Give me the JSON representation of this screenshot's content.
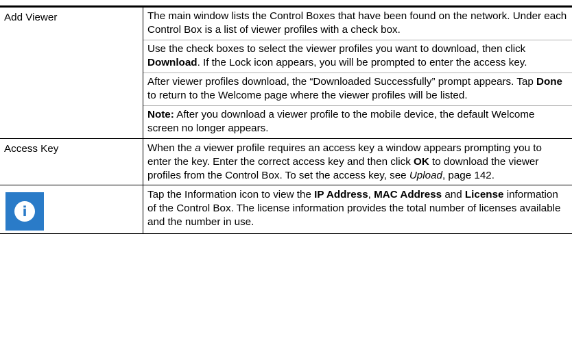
{
  "rows": [
    {
      "label": "Add Viewer",
      "paragraphs": [
        {
          "text": "The main window lists the Control Boxes that have been found on the network. Under each Control Box is a list of viewer profiles with a check box."
        },
        {
          "p1": "Use the check boxes to select the viewer profiles you want to download, then click ",
          "b1": "Download",
          "p2": ". If the Lock icon appears, you will be prompted to enter the access key."
        },
        {
          "p1": "After viewer profiles download, the “Downloaded Successfully” prompt appears. Tap ",
          "b1": "Done",
          "p2": " to return to the Welcome page where the viewer profiles will be listed."
        },
        {
          "b1": "Note:",
          "p1": " After you download a viewer profile to the mobile device, the default Welcome screen no longer appears."
        }
      ]
    },
    {
      "label": "Access Key",
      "paragraph": {
        "p1": "When the ",
        "i1": "a",
        "p2": " viewer profile requires an access key a window appears prompting you to enter the key. Enter the correct access key and then click ",
        "b1": "OK",
        "p3": " to download the viewer profiles from the Control Box. To set the access key, see ",
        "i2": "Upload",
        "p4": ", page 142."
      }
    },
    {
      "icon": "info-icon",
      "icon_glyph": "i",
      "icon_color": "#2a7bc8",
      "paragraph": {
        "p1": "Tap the Information icon to view the ",
        "b1": "IP Address",
        "p2": ", ",
        "b2": "MAC Address",
        "p3": " and ",
        "b3": "License",
        "p4": " information of the Control Box. The license information provides the total number of licenses available and the number in use."
      }
    }
  ]
}
